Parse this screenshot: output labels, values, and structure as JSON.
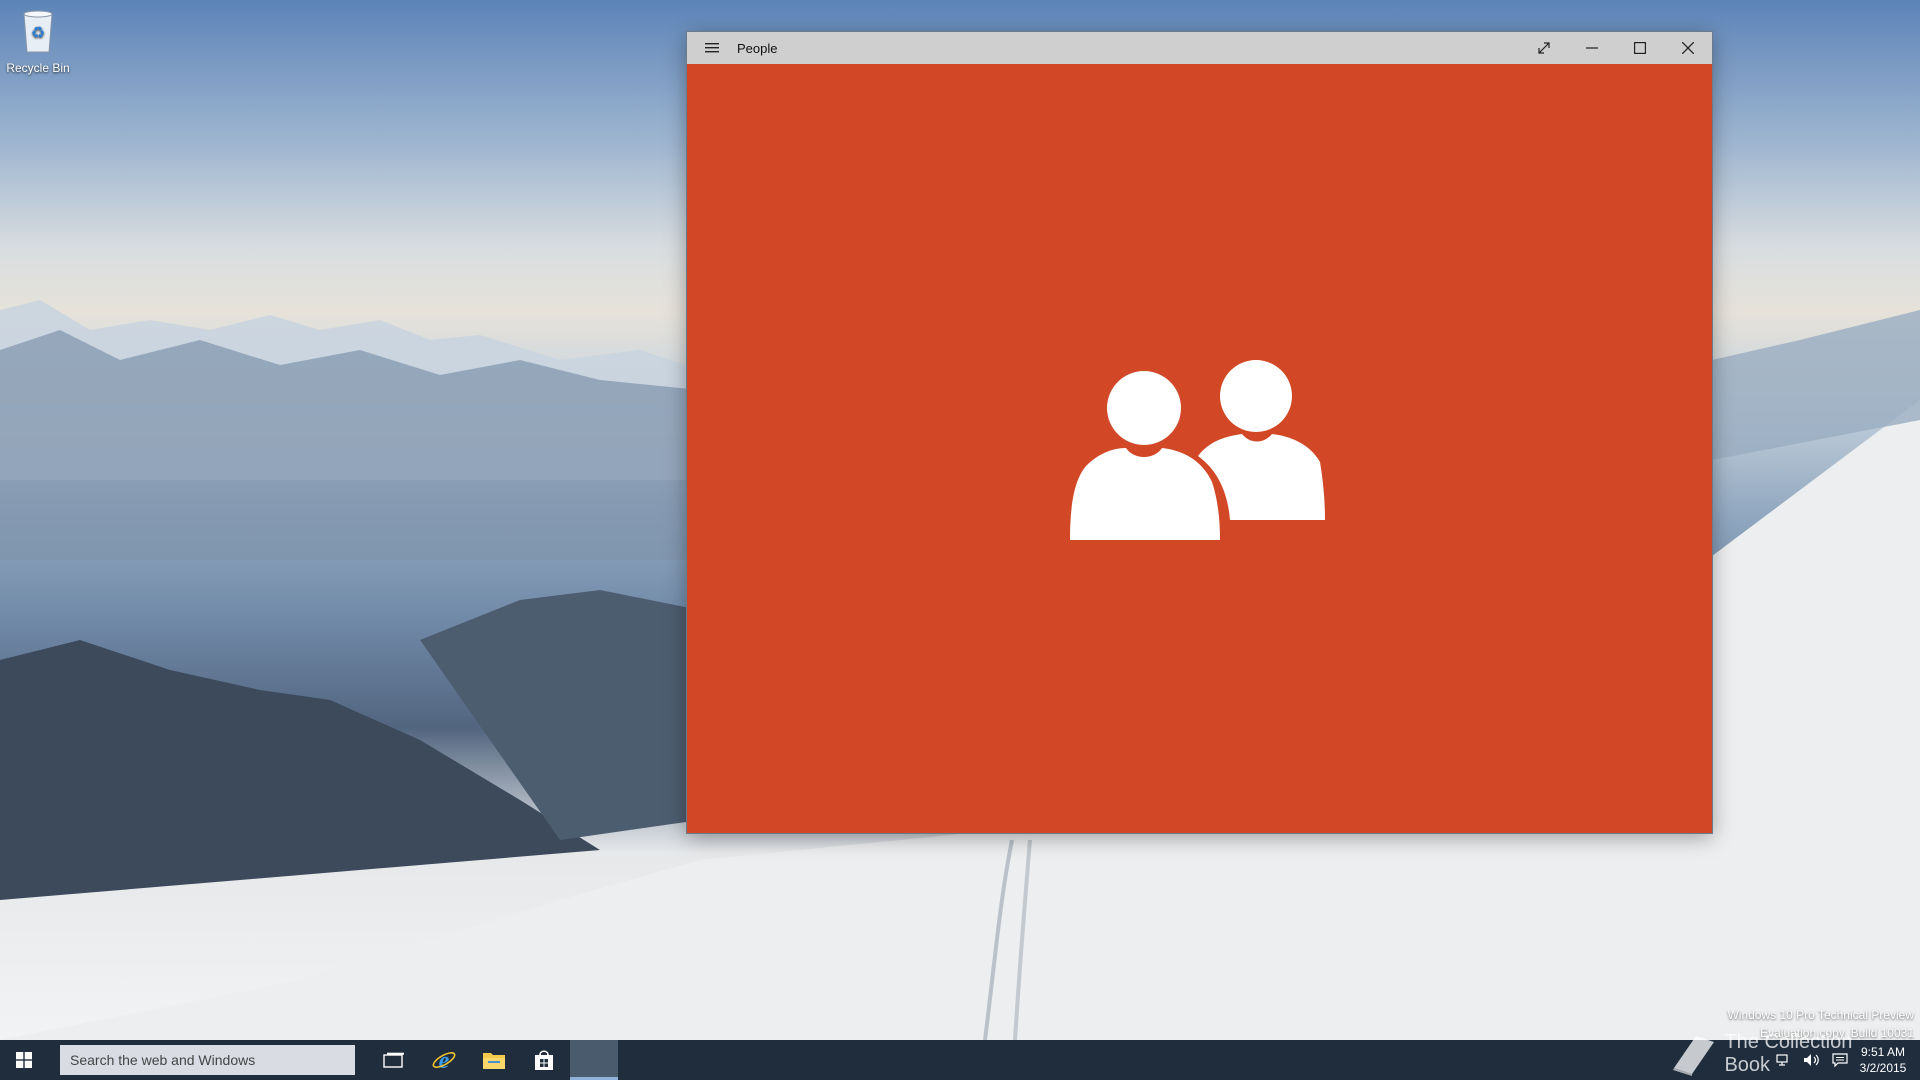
{
  "desktop": {
    "icons": [
      {
        "label": "Recycle Bin"
      }
    ]
  },
  "window": {
    "title": "People",
    "accent_color": "#d24726",
    "titlebar_color": "#cfcfcf",
    "buttons": {
      "menu": "hamburger-icon",
      "fullscreen": "expand-icon",
      "minimize": "minimize-icon",
      "maximize": "maximize-icon",
      "close": "close-icon"
    },
    "splash_icon": "people-icon"
  },
  "taskbar": {
    "search_placeholder": "Search the web and Windows",
    "pinned": [
      "task-view-icon",
      "internet-explorer-icon",
      "file-explorer-icon",
      "store-icon"
    ],
    "active_app": "people-app",
    "tray": {
      "time": "9:51 AM",
      "date": "3/2/2015"
    }
  },
  "watermark": {
    "line1": "Windows 10 Pro Technical Preview",
    "line2": "Evaluation copy. Build 10031"
  },
  "overlay_brand": "The Collection Book"
}
